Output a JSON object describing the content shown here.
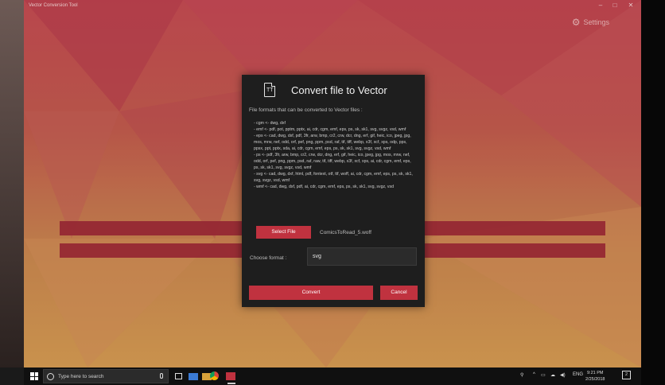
{
  "window": {
    "title": "Vector Conversion Tool"
  },
  "settings": {
    "label": "Settings",
    "icon": "gear-icon"
  },
  "dialog": {
    "title": "Convert file to Vector",
    "subtitle": "File formats that can be converted to Vector files :",
    "formats": [
      "- cgm <- dwg, dxf",
      "- emf <- pdf, pot, pptm, pptx, ai, cdr, cgm, emf, eps, ps, sk, sk1, svg, svgz, vsd, wmf",
      "- eps <- cad, dwg, dxf, pdf, 3fr, arw, bmp, cr2, crw, dcr, dng, erf, gif, heic, ico, jpeg, jpg, mos, mrw, nef, odd, orf, pef, png, ppm, psd, raf, tif, tiff, webp, x3f, xcf, xps, odp, pps, ppsx, ppt, pptx, sda, ai, cdr, cgm, emf, eps, ps, sk, sk1, svg, svgz, vsd, wmf",
      "- ps <- pdf, 3fr, arw, bmp, cr2, crw, dcr, dng, erf, gif, heic, ico, jpeg, jpg, mos, mrw, nef, odd, orf, pef, png, ppm, psd, raf, raw, tif, tiff, webp, x3f, xcf, xps, ai, cdr, cgm, emf, eps, ps, sk, sk1, svg, svgz, vsd, wmf",
      "- svg <- cad, dwg, dxf, html, pdf, fontext, otf, ttf, woff, ai, cdr, cgm, emf, eps, ps, sk, sk1, svg, svgz, vsd, wmf",
      "- wmf <- cad, dwg, dxf, pdf, ai, cdr, cgm, emf, eps, ps, sk, sk1, svg, svgz, vsd"
    ],
    "select_label": "Select File",
    "selected_file": "ComicsToRead_5.woff",
    "format_label": "Choose format :",
    "format_value": "svg",
    "convert_label": "Convert",
    "cancel_label": "Cancel"
  },
  "taskbar": {
    "search_placeholder": "Type here to search",
    "tray_lang": "ENG",
    "time": "9:21 PM",
    "date": "2/25/2018",
    "notification_count": "2"
  },
  "colors": {
    "accent": "#c0323f",
    "dialog_bg": "#1e1e1e",
    "bar": "#9e2b36"
  }
}
